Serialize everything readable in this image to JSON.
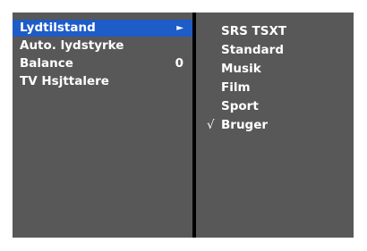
{
  "menu": {
    "items": [
      {
        "label": "Lydtilstand",
        "suffix": "►"
      },
      {
        "label": "Auto. lydstyrke",
        "suffix": ""
      },
      {
        "label": "Balance",
        "suffix": "0"
      },
      {
        "label": "TV Hsjttalere",
        "suffix": ""
      }
    ],
    "selected_index": 0
  },
  "submenu": {
    "options": [
      "SRS TSXT",
      "Standard",
      "Musik",
      "Film",
      "Sport",
      "Bruger"
    ],
    "checked_index": 5,
    "check_symbol": "√"
  },
  "colors": {
    "panel_bg": "#585858",
    "selection": "#1e5cc8",
    "frame": "#000000",
    "text": "#ffffff"
  }
}
